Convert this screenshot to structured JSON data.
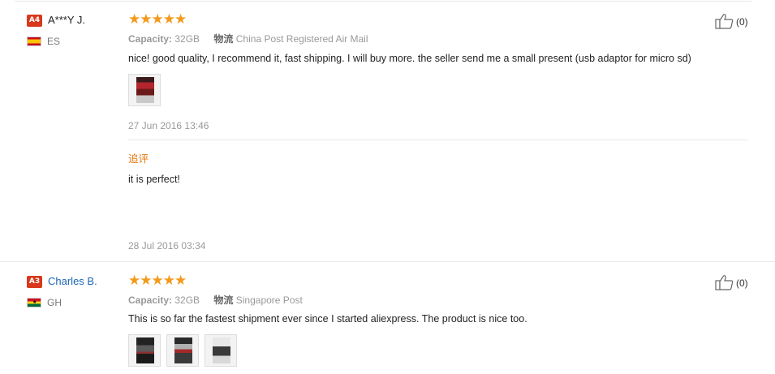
{
  "reviews": [
    {
      "badge": "A4",
      "name": "A***Y J.",
      "country": "ES",
      "rating": 5,
      "stars_text": "★★★★★",
      "capacity_label": "Capacity:",
      "capacity_value": "32GB",
      "shipping_label": "物流",
      "shipping_value": "China Post Registered Air Mail",
      "text": "nice! good quality, I recommend it, fast shipping. I will buy more. the seller send me a small present (usb adaptor for micro sd)",
      "date": "27 Jun 2016 13:46",
      "additional_label": "追评",
      "additional_text": "it is perfect!",
      "additional_date": "28 Jul 2016 03:34",
      "helpful_count": "(0)"
    },
    {
      "badge": "A3",
      "name": "Charles B.",
      "country": "GH",
      "rating": 5,
      "stars_text": "★★★★★",
      "capacity_label": "Capacity:",
      "capacity_value": "32GB",
      "shipping_label": "物流",
      "shipping_value": "Singapore Post",
      "text": "This is so far the fastest shipment ever since I started aliexpress. The product is nice too.",
      "helpful_count": "(0)"
    }
  ],
  "colors": {
    "badge": "#d8381c",
    "star": "#f29a1c",
    "link": "#1c65b4",
    "additional_label": "#e8760c"
  },
  "icons": {
    "helpful": "thumbs-up-icon",
    "flag_es": "spain-flag-icon",
    "flag_gh": "ghana-flag-icon"
  }
}
